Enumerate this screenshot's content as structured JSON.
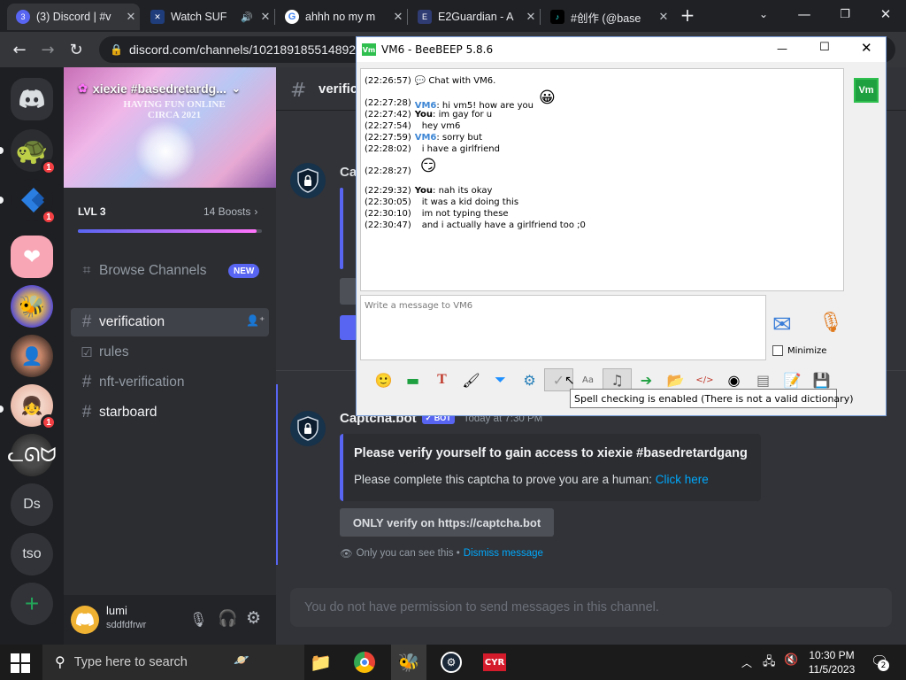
{
  "browser": {
    "tabs": [
      {
        "title": "(3) Discord | #v",
        "icon": "discord-icon",
        "color": "#5865f2",
        "badge": "3"
      },
      {
        "title": "Watch SUF",
        "icon": "video-icon",
        "color": "#1f3d7a"
      },
      {
        "title": "ahhh no my m",
        "icon": "google-icon",
        "color": "#ffffff"
      },
      {
        "title": "E2Guardian - A",
        "icon": "e2guardian-icon",
        "color": "#2f3b73"
      },
      {
        "title": "#创作 (@base",
        "icon": "tiktok-icon",
        "color": "#000000"
      }
    ],
    "url": "discord.com/channels/1021891855148924"
  },
  "discord": {
    "server_name": "xiexie #basedretardg...",
    "banner_text": "HAVING FUN ONLINE CIRCA 2021",
    "level": "LVL 3",
    "boosts": "14 Boosts",
    "boost_progress": 0.97,
    "channels": [
      {
        "name": "Browse Channels",
        "type": "browse",
        "badge": "NEW"
      },
      {
        "name": "verification",
        "type": "text",
        "selected": true
      },
      {
        "name": "rules",
        "type": "rules"
      },
      {
        "name": "nft-verification",
        "type": "text"
      },
      {
        "name": "starboard",
        "type": "text",
        "unread": true
      }
    ],
    "header_channel": "verifica",
    "guild_labels": {
      "ds": "Ds",
      "tso": "tso",
      "add": "+"
    },
    "guild_badges": [
      "1",
      "1",
      "1"
    ],
    "user": {
      "name": "lumi",
      "tag": "sddfdfrwr"
    },
    "message": {
      "author": "Captcha.bot",
      "bot_tag": "BOT",
      "time": "Today at 7:30 PM",
      "embed_title": "Please verify yourself to gain access to xiexie #basedretardgang",
      "embed_desc": "Please complete this captcha to prove you are a human:",
      "embed_link": "Click here",
      "button": "ONLY verify on https://captcha.bot",
      "ephemeral_note": "Only you can see this •",
      "dismiss": "Dismiss message"
    },
    "partial_author": "Cap",
    "no_permission": "You do not have permission to send messages in this channel."
  },
  "beebeep": {
    "title": "VM6 - BeeBEEP 5.8.6",
    "avatar": "Vm",
    "chat": [
      {
        "time": "(22:26:57)",
        "who": "",
        "text": "Chat with VM6.",
        "kind": "system"
      },
      {
        "time": "(22:27:28)",
        "who": "VM6",
        "text": ": hi vm5! how are you",
        "kind": "other",
        "emoji": "😀"
      },
      {
        "time": "(22:27:42)",
        "who": "You",
        "text": ": im gay for u",
        "kind": "me"
      },
      {
        "time": "(22:27:54)",
        "who": "",
        "text": "hey vm6",
        "kind": "cont"
      },
      {
        "time": "(22:27:59)",
        "who": "VM6",
        "text": ": sorry but",
        "kind": "other"
      },
      {
        "time": "(22:28:02)",
        "who": "",
        "text": "i have a girlfriend",
        "kind": "cont"
      },
      {
        "time": "(22:28:27)",
        "who": "",
        "text": "",
        "kind": "emoji",
        "emoji": "😏"
      },
      {
        "time": "(22:29:32)",
        "who": "You",
        "text": ": nah its okay",
        "kind": "me"
      },
      {
        "time": "(22:30:05)",
        "who": "",
        "text": "it was a kid doing this",
        "kind": "cont"
      },
      {
        "time": "(22:30:10)",
        "who": "",
        "text": "im not typing these",
        "kind": "cont"
      },
      {
        "time": "(22:30:47)",
        "who": "",
        "text": "and i actually have a girlfriend too ;0",
        "kind": "cont"
      }
    ],
    "input_placeholder": "Write a message to VM6",
    "minimize_label": "Minimize",
    "tooltip": "Spell checking is enabled (There is not a valid dictionary)"
  },
  "taskbar": {
    "search_placeholder": "Type here to search",
    "time": "10:30 PM",
    "date": "11/5/2023",
    "notifications": "2"
  }
}
